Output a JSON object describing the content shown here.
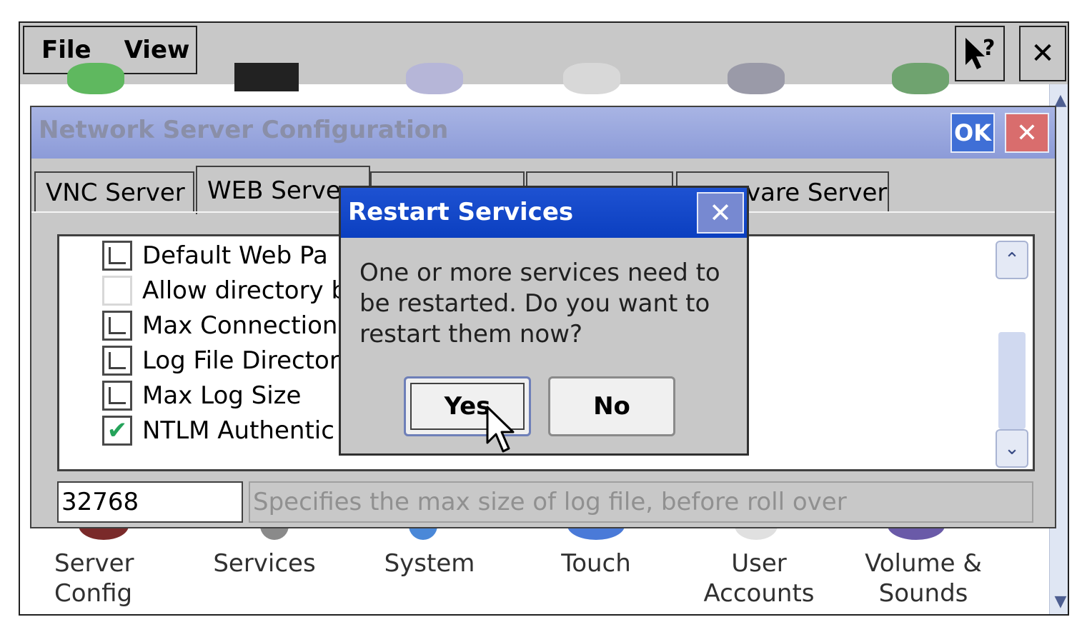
{
  "menubar": {
    "menu_items": [
      "File",
      "View"
    ],
    "help_icon": "pointer-help-icon",
    "close_label": "✕"
  },
  "control_panel": {
    "labels": [
      {
        "line1": "Server",
        "line2": "Config"
      },
      {
        "line1": "Services",
        "line2": ""
      },
      {
        "line1": "System",
        "line2": ""
      },
      {
        "line1": "Touch",
        "line2": ""
      },
      {
        "line1": "User",
        "line2": "Accounts"
      },
      {
        "line1": "Volume &",
        "line2": "Sounds"
      }
    ]
  },
  "network_config": {
    "title": "Network Server Configuration",
    "ok_label": "OK",
    "close_label": "✕",
    "tabs": [
      "VNC Server",
      "WEB Serve",
      "",
      "",
      "vare Server"
    ],
    "list_items": [
      {
        "label": "Default Web Pa",
        "state": "partial"
      },
      {
        "label": "Allow directory b",
        "state": "empty"
      },
      {
        "label": "Max Connection",
        "state": "partial"
      },
      {
        "label": "Log File Director",
        "state": "partial"
      },
      {
        "label": "Max Log Size",
        "state": "partial"
      },
      {
        "label": "NTLM Authentic",
        "state": "checked"
      }
    ],
    "value": "32768",
    "description": "Specifies the max size of log file, before roll over"
  },
  "restart_dialog": {
    "title": "Restart Services",
    "close_label": "✕",
    "message": "One or more services need to be restarted. Do you want to restart them now?",
    "yes_label": "Yes",
    "no_label": "No"
  },
  "colors": {
    "dialog_title": "#1e52d2",
    "inactive_title": "#8c9bd8",
    "check": "#25a35a"
  }
}
